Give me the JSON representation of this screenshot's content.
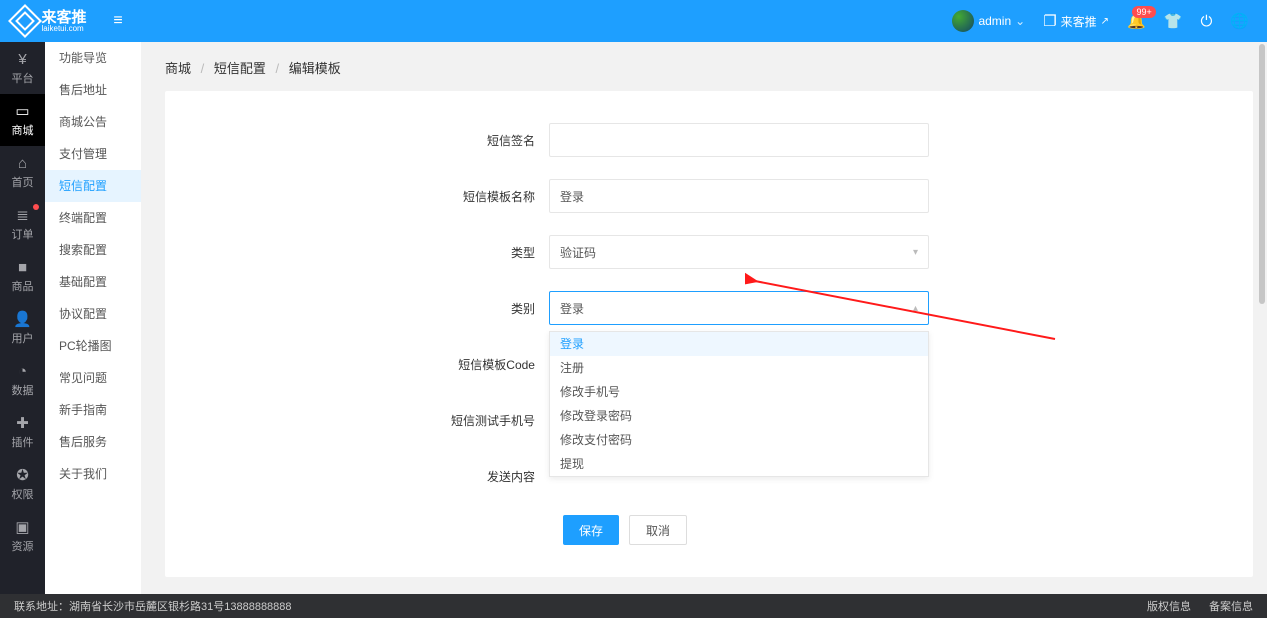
{
  "header": {
    "brand_cn": "来客推",
    "brand_en": "laiketui.com",
    "user": "admin",
    "lkt_label": "来客推",
    "notify_badge": "99+"
  },
  "leftnav": [
    {
      "icon": "¥",
      "label": "平台",
      "active": false
    },
    {
      "icon": "▭",
      "label": "商城",
      "active": true
    },
    {
      "icon": "⌂",
      "label": "首页",
      "active": false
    },
    {
      "icon": "≣",
      "label": "订单",
      "active": false,
      "dot": true
    },
    {
      "icon": "■",
      "label": "商品",
      "active": false
    },
    {
      "icon": "👤",
      "label": "用户",
      "active": false
    },
    {
      "icon": "◔",
      "label": "数据",
      "active": false
    },
    {
      "icon": "✚",
      "label": "插件",
      "active": false
    },
    {
      "icon": "✪",
      "label": "权限",
      "active": false
    },
    {
      "icon": "▣",
      "label": "资源",
      "active": false
    }
  ],
  "secnav": [
    {
      "label": "功能导览",
      "active": false
    },
    {
      "label": "售后地址",
      "active": false
    },
    {
      "label": "商城公告",
      "active": false
    },
    {
      "label": "支付管理",
      "active": false
    },
    {
      "label": "短信配置",
      "active": true
    },
    {
      "label": "终端配置",
      "active": false
    },
    {
      "label": "搜索配置",
      "active": false
    },
    {
      "label": "基础配置",
      "active": false
    },
    {
      "label": "协议配置",
      "active": false
    },
    {
      "label": "PC轮播图",
      "active": false
    },
    {
      "label": "常见问题",
      "active": false
    },
    {
      "label": "新手指南",
      "active": false
    },
    {
      "label": "售后服务",
      "active": false
    },
    {
      "label": "关于我们",
      "active": false
    }
  ],
  "breadcrumb": {
    "a": "商城",
    "b": "短信配置",
    "c": "编辑模板"
  },
  "form": {
    "labels": {
      "sign": "短信签名",
      "tplname": "短信模板名称",
      "type": "类型",
      "category": "类别",
      "code": "短信模板Code",
      "test_phone": "短信测试手机号",
      "send_content": "发送内容"
    },
    "values": {
      "sign": "",
      "tplname": "登录",
      "type": "验证码",
      "category": "登录",
      "code": "",
      "test_phone": "",
      "send_content": ""
    },
    "category_options": [
      "登录",
      "注册",
      "修改手机号",
      "修改登录密码",
      "修改支付密码",
      "提现"
    ],
    "buttons": {
      "save": "保存",
      "cancel": "取消"
    }
  },
  "footer": {
    "contact": "联系地址：湖南省长沙市岳麓区银杉路31号13888888888",
    "copyright": "版权信息",
    "record": "备案信息"
  }
}
